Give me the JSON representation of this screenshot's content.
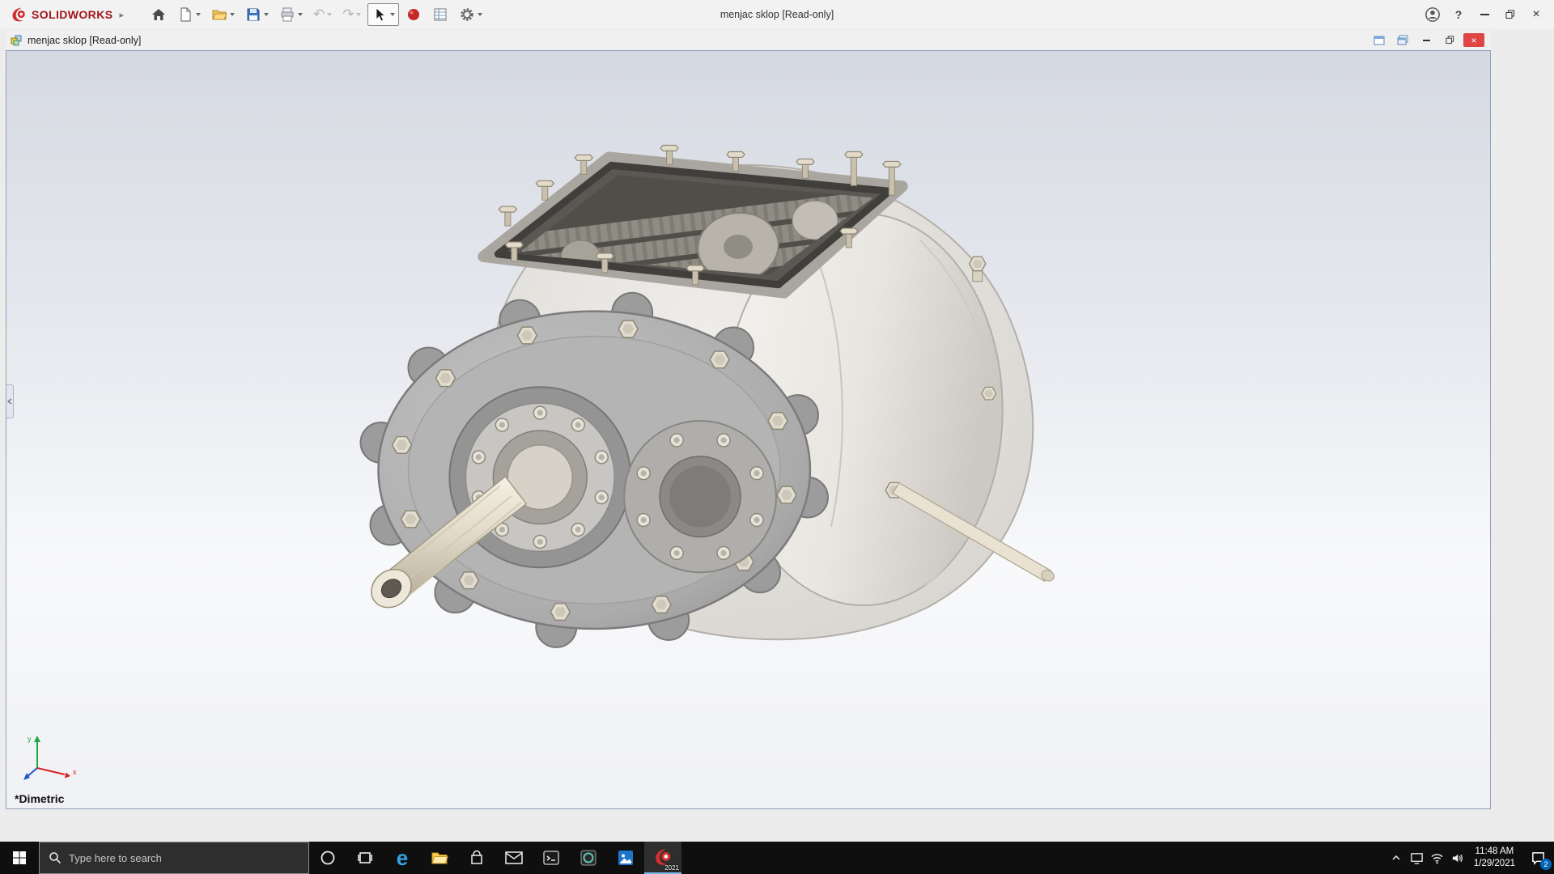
{
  "titlebar": {
    "brand": "SOLIDWORKS",
    "window_title": "menjac sklop [Read-only]"
  },
  "docbar": {
    "doc_title": "menjac sklop [Read-only]"
  },
  "viewport": {
    "view_orientation": "*Dimetric",
    "triad": {
      "x_label": "x",
      "y_label": "y"
    }
  },
  "taskbar": {
    "search_placeholder": "Type here to search",
    "clock": {
      "time": "11:48 AM",
      "date": "1/29/2021"
    },
    "notification_count": "2",
    "solidworks_year": "2021"
  },
  "icons": {
    "menu_expand": "▸",
    "undo": "↶",
    "redo": "↷",
    "help": "?",
    "close": "×",
    "edge": "e"
  },
  "colors": {
    "accent_red": "#d32f2f",
    "close_red": "#df4545",
    "taskbar_bg": "#0f0f0f",
    "viewport_border": "#8fa0ba",
    "badge_blue": "#0065b8"
  }
}
